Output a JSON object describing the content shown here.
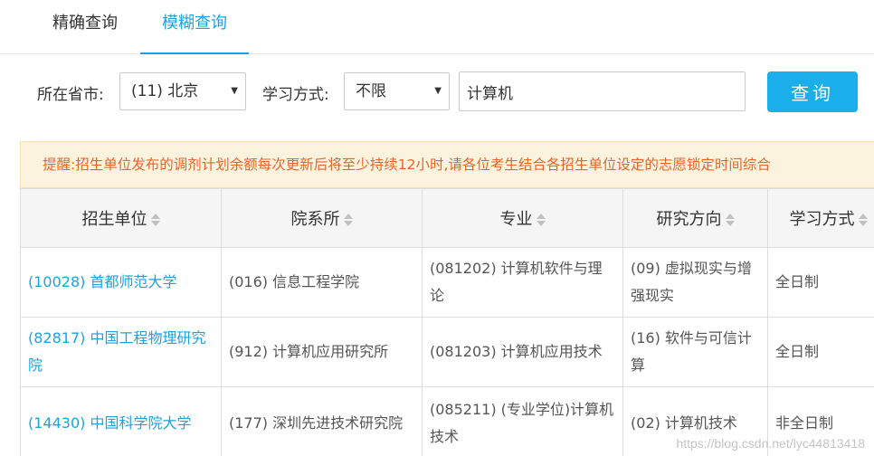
{
  "tabs": [
    {
      "label": "精确查询"
    },
    {
      "label": "模糊查询"
    }
  ],
  "filters": {
    "province_label": "所在省市:",
    "province_value": "(11) 北京",
    "mode_label": "学习方式:",
    "mode_value": "不限",
    "keyword_value": "计算机",
    "query_label": "查询"
  },
  "notice": "提醒:招生单位发布的调剂计划余额每次更新后将至少持续12小时,请各位考生结合各招生单位设定的志愿锁定时间综合",
  "table": {
    "headers": [
      "招生单位",
      "院系所",
      "专业",
      "研究方向",
      "学习方式"
    ],
    "rows": [
      [
        "(10028) 首都师范大学",
        "(016) 信息工程学院",
        "(081202) 计算机软件与理论",
        "(09) 虚拟现实与增强现实",
        "全日制"
      ],
      [
        "(82817) 中国工程物理研究院",
        "(912) 计算机应用研究所",
        "(081203) 计算机应用技术",
        "(16) 软件与可信计算",
        "全日制"
      ],
      [
        "(14430) 中国科学院大学",
        "(177) 深圳先进技术研究院",
        "(085211) (专业学位)计算机技术",
        "(02) 计算机技术",
        "非全日制"
      ]
    ]
  },
  "watermark": "https://blog.csdn.net/lyc44813418",
  "colors": {
    "accent": "#1aa3e0",
    "button": "#1aaeea",
    "notice_bg": "#fcf3de",
    "notice_text": "#e8652a"
  }
}
